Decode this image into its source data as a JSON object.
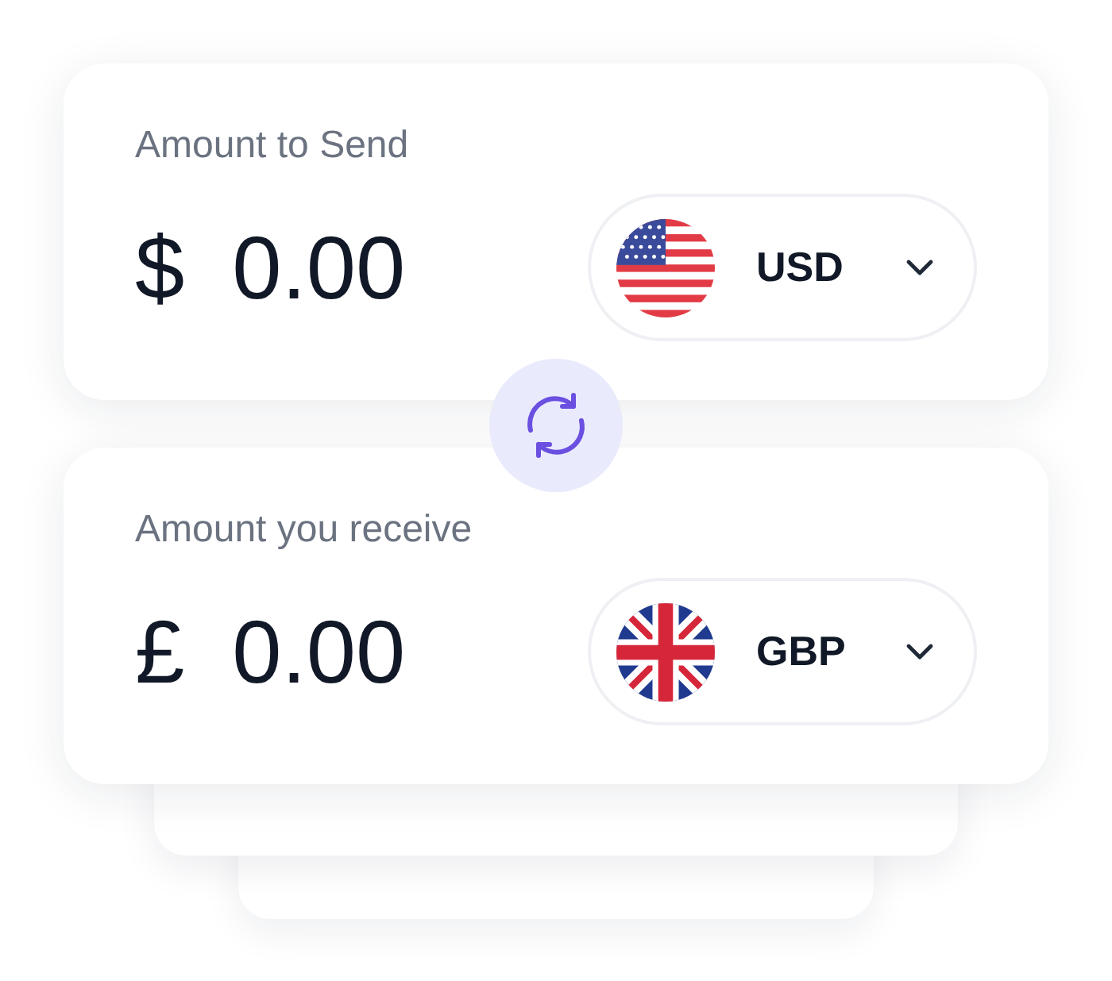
{
  "cards": [
    {
      "label": "Amount to Send",
      "symbol": "$",
      "amount": "0.00",
      "currency": {
        "code": "USD",
        "kind": "us"
      }
    },
    {
      "label": "Amount you receive",
      "symbol": "£",
      "amount": "0.00",
      "currency": {
        "code": "GBP",
        "kind": "gb"
      }
    }
  ]
}
